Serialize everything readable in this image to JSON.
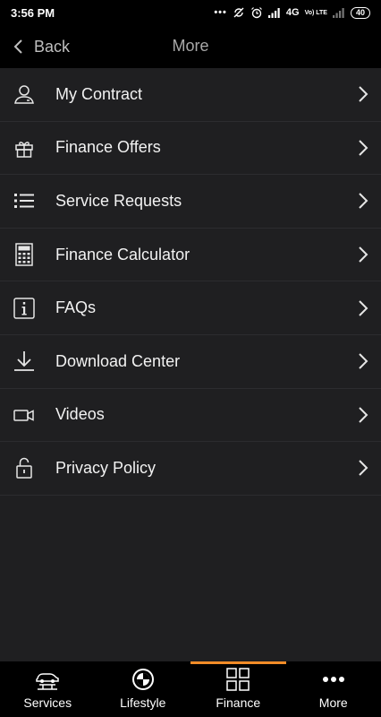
{
  "status_bar": {
    "time": "3:56 PM",
    "dots": "•••",
    "network": "4G",
    "volte": "Vo) LTE",
    "battery": "40"
  },
  "nav": {
    "back_label": "Back",
    "title": "More"
  },
  "menu": {
    "items": [
      {
        "label": "My Contract",
        "icon": "user-contract-icon"
      },
      {
        "label": "Finance Offers",
        "icon": "gift-icon"
      },
      {
        "label": "Service Requests",
        "icon": "list-icon"
      },
      {
        "label": "Finance Calculator",
        "icon": "calculator-icon"
      },
      {
        "label": "FAQs",
        "icon": "info-icon"
      },
      {
        "label": "Download Center",
        "icon": "download-icon"
      },
      {
        "label": "Videos",
        "icon": "video-camera-icon"
      },
      {
        "label": "Privacy Policy",
        "icon": "padlock-icon"
      }
    ]
  },
  "tabs": [
    {
      "label": "Services",
      "icon": "car-lift-icon"
    },
    {
      "label": "Lifestyle",
      "icon": "bmw-logo-icon"
    },
    {
      "label": "Finance",
      "icon": "grid-icon",
      "active": true
    },
    {
      "label": "More",
      "icon": "more-dots-icon"
    }
  ],
  "colors": {
    "background": "#1f1f21",
    "bars": "#000000",
    "accent": "#f28c28",
    "text": "#f2f2f2"
  }
}
